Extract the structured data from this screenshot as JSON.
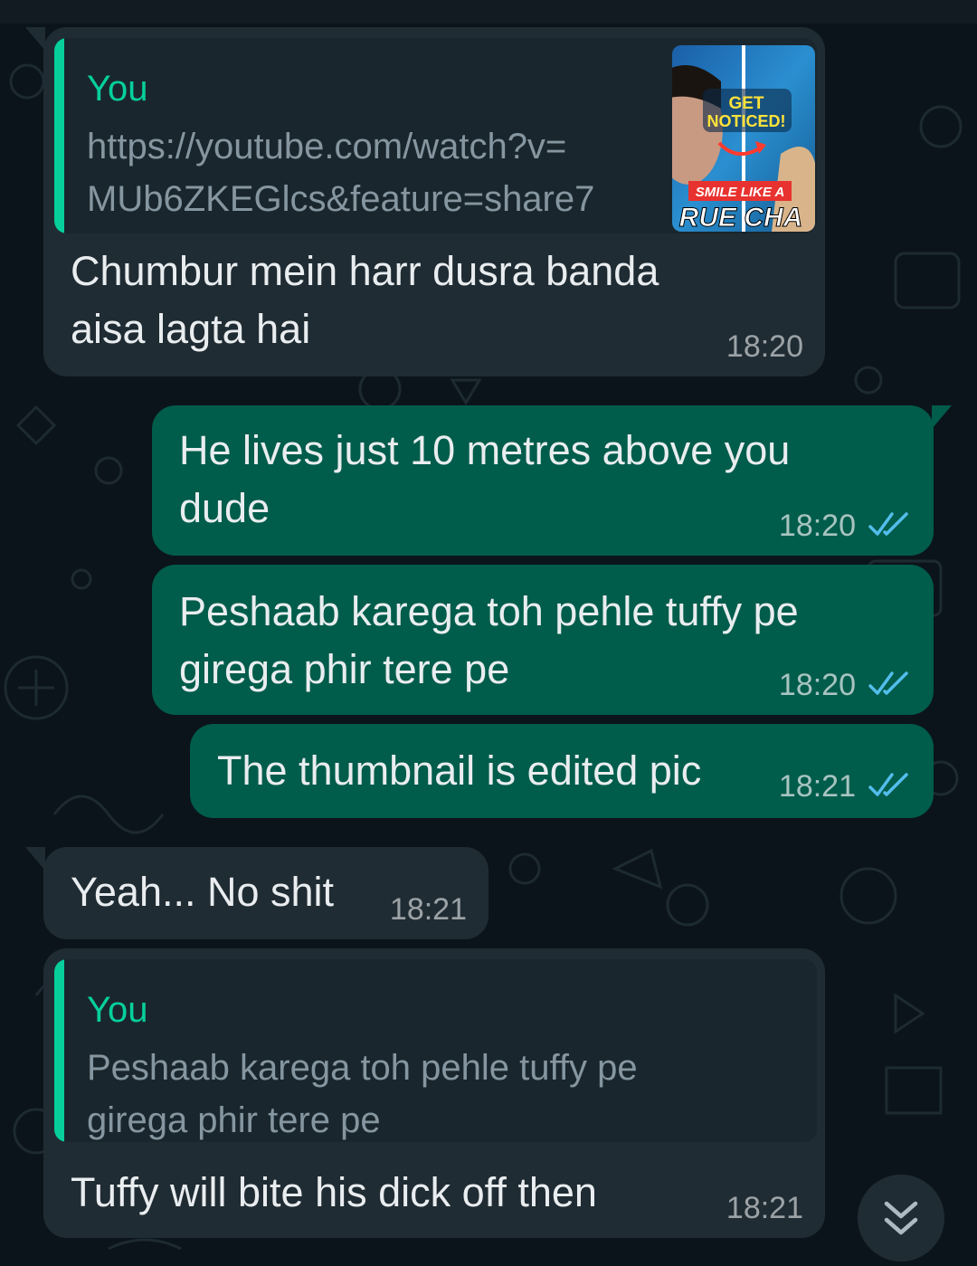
{
  "colors": {
    "background": "#0b141a",
    "incoming_bubble": "#202c33",
    "outgoing_bubble": "#005c4b",
    "quote_accent": "#06cf9c",
    "read_ticks": "#53bdeb"
  },
  "messages": [
    {
      "direction": "incoming",
      "quoted": {
        "author": "You",
        "text_line1": "https://youtube.com/watch?v=",
        "text_line2": "MUb6ZKEGlcs&feature=share7",
        "thumbnail": {
          "badge_line1": "GET",
          "badge_line2": "NOTICED!",
          "caption_small": "SMILE LIKE A",
          "caption_big": "RUE CHA"
        }
      },
      "line1": "Chumbur mein harr dusra banda",
      "line2": "aisa lagta hai",
      "time": "18:20"
    },
    {
      "direction": "outgoing",
      "line1": "He lives just 10 metres above you",
      "line2": "dude",
      "time": "18:20",
      "status_icon": "double-check-read-icon"
    },
    {
      "direction": "outgoing",
      "line1": "Peshaab karega toh pehle tuffy pe",
      "line2": "girega phir tere pe",
      "time": "18:20",
      "status_icon": "double-check-read-icon"
    },
    {
      "direction": "outgoing",
      "line1": "The thumbnail is edited pic",
      "time": "18:21",
      "status_icon": "double-check-read-icon"
    },
    {
      "direction": "incoming",
      "line1": "Yeah... No shit",
      "time": "18:21"
    },
    {
      "direction": "incoming",
      "quoted": {
        "author": "You",
        "text_line1": "Peshaab karega toh pehle tuffy pe",
        "text_line2": "girega phir tere pe"
      },
      "line1": "Tuffy will bite his dick off then",
      "time": "18:21"
    }
  ],
  "scroll_button_icon": "chevrons-down-icon"
}
